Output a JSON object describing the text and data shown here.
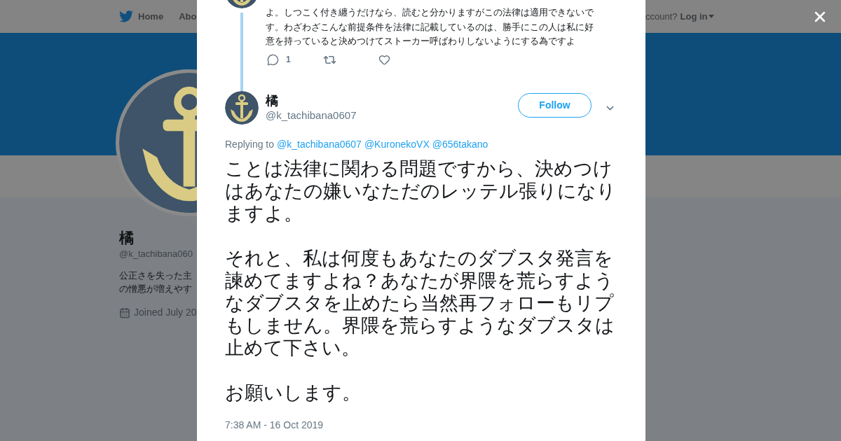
{
  "background_page": {
    "nav": {
      "home": "Home",
      "about_partial": "Abo",
      "account_prompt_partial": "ccount?",
      "login": "Log in"
    },
    "profile": {
      "name": "橘",
      "handle": "@k_tachibana060",
      "bio_lines": [
        "公正さを失った主",
        "の憎悪が増えやす"
      ],
      "joined": "Joined July 20"
    }
  },
  "parent_tweet": {
    "text": "よ。しつこく付き纏うだけなら、読むと分かりますがこの法律は適用できないです。わざわざこんな前提条件を法律に記載しているのは、勝手にこの人は私に好意を持っていると決めつけてストーカー呼ばわりしないようにする為ですよ",
    "reply_count": "1"
  },
  "tweet": {
    "name": "橘",
    "handle": "@k_tachibana0607",
    "follow_button": "Follow",
    "replying_to_label": "Replying to",
    "mentions": [
      "@k_tachibana0607",
      "@KuronekoVX",
      "@656takano"
    ],
    "paragraphs": [
      "ことは法律に関わる問題ですから、決めつけはあなたの嫌いなただのレッテル張りになりますよ。",
      "それと、私は何度もあなたのダブスタ発言を諫めてますよね？あなたが界隈を荒らすようなダブスタを止めたら当然再フォローもリプもしません。界隈を荒らすようなダブスタは止めて下さい。",
      "お願いします。"
    ],
    "timestamp": "7:38 AM - 16 Oct 2019"
  }
}
